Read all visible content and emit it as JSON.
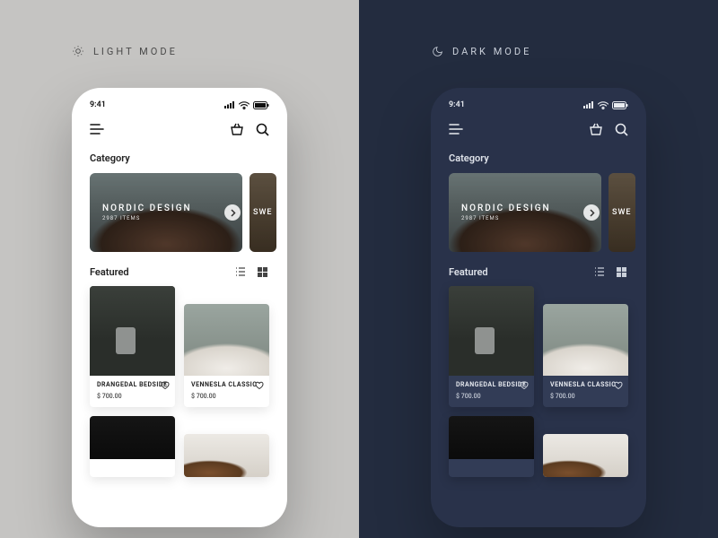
{
  "modes": {
    "light_label": "LIGHT MODE",
    "dark_label": "DARK MODE"
  },
  "status": {
    "time": "9:41"
  },
  "sections": {
    "category_title": "Category",
    "featured_title": "Featured"
  },
  "categories": [
    {
      "title": "NORDIC DESIGN",
      "subtitle": "2987 ITEMS"
    },
    {
      "title": "SWE",
      "subtitle": ""
    }
  ],
  "products": [
    {
      "name": "DRANGEDAL BEDSIDE",
      "price": "$ 700.00"
    },
    {
      "name": "VENNESLA CLASSIC",
      "price": "$ 700.00"
    },
    {
      "name": "",
      "price": ""
    },
    {
      "name": "",
      "price": ""
    }
  ]
}
